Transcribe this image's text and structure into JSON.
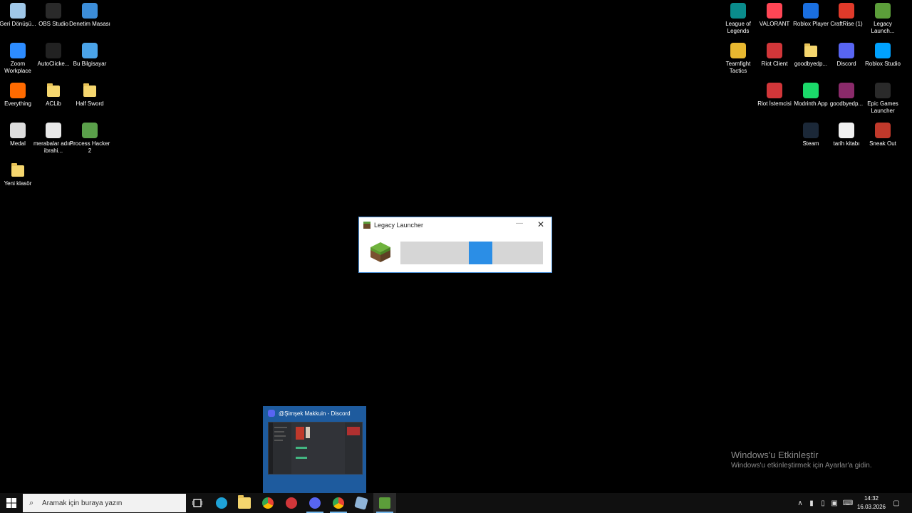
{
  "desktop": {
    "left_icons": [
      {
        "label": "Geri Dönüşü...",
        "icon": "recycle-bin-icon",
        "color": "#9fc7e8"
      },
      {
        "label": "OBS Studio",
        "icon": "obs-icon",
        "color": "#2a2a2a"
      },
      {
        "label": "Denetim Masası",
        "icon": "control-panel-icon",
        "color": "#3c8dd8"
      },
      {
        "label": "Zoom Workplace",
        "icon": "zoom-icon",
        "color": "#2d8cff"
      },
      {
        "label": "AutoClicke...",
        "icon": "mouse-icon",
        "color": "#222222"
      },
      {
        "label": "Bu Bilgisayar",
        "icon": "computer-icon",
        "color": "#4aa3e8"
      },
      {
        "label": "Everything",
        "icon": "everything-icon",
        "color": "#ff6a00"
      },
      {
        "label": "ACLib",
        "icon": "folder-icon",
        "color": "#f5d66e"
      },
      {
        "label": "Half Sword",
        "icon": "folder-icon",
        "color": "#f5d66e"
      },
      {
        "label": "Medal",
        "icon": "medal-icon",
        "color": "#dddddd"
      },
      {
        "label": "merabalar adım ibrahi...",
        "icon": "image-file-icon",
        "color": "#e8e8e8"
      },
      {
        "label": "Process Hacker 2",
        "icon": "process-hacker-icon",
        "color": "#5aa04a"
      },
      {
        "label": "Yeni klasör",
        "icon": "folder-icon",
        "color": "#f5d66e"
      }
    ],
    "right_icons": [
      {
        "label": "League of Legends",
        "icon": "league-icon",
        "color": "#0a8c8c"
      },
      {
        "label": "VALORANT",
        "icon": "valorant-icon",
        "color": "#ff4655"
      },
      {
        "label": "Roblox Player",
        "icon": "roblox-icon",
        "color": "#1a6fe0"
      },
      {
        "label": "CraftRise (1)",
        "icon": "craftrise-icon",
        "color": "#e03a2a"
      },
      {
        "label": "Legacy Launch...",
        "icon": "minecraft-icon",
        "color": "#5c9e3a"
      },
      {
        "label": "Teamfight Tactics",
        "icon": "tft-icon",
        "color": "#e8b830"
      },
      {
        "label": "Riot Client",
        "icon": "riot-icon",
        "color": "#d13639"
      },
      {
        "label": "goodbyedp...",
        "icon": "folder-icon",
        "color": "#f5d66e"
      },
      {
        "label": "Discord",
        "icon": "discord-icon",
        "color": "#5865f2"
      },
      {
        "label": "Roblox Studio",
        "icon": "roblox-studio-icon",
        "color": "#00a2ff"
      },
      {
        "label": "Riot İstemcisi",
        "icon": "riot-icon",
        "color": "#d13639"
      },
      {
        "label": "Modrinth App",
        "icon": "modrinth-icon",
        "color": "#1bd96a"
      },
      {
        "label": "goodbyedp...",
        "icon": "winrar-icon",
        "color": "#8a2a6a"
      },
      {
        "label": "Epic Games Launcher",
        "icon": "epic-icon",
        "color": "#2a2a2a"
      },
      {
        "label": "Steam",
        "icon": "steam-icon",
        "color": "#1b2838"
      },
      {
        "label": "tarih kitabı",
        "icon": "text-file-icon",
        "color": "#f0f0f0"
      },
      {
        "label": "Sneak Out",
        "icon": "sneak-out-icon",
        "color": "#c0392b"
      }
    ]
  },
  "launcher": {
    "title": "Legacy Launcher",
    "close_glyph": "✕",
    "minimize_glyph": "—",
    "progress": 0.48
  },
  "preview": {
    "title": "@Şimşek Makkuin - Discord"
  },
  "watermark": {
    "line1": "Windows'u Etkinleştir",
    "line2": "Windows'u etkinleştirmek için Ayarlar'a gidin."
  },
  "taskbar": {
    "search_placeholder": "Aramak için buraya yazın",
    "clock_time": "14:32",
    "clock_date": "16.03.2026"
  }
}
